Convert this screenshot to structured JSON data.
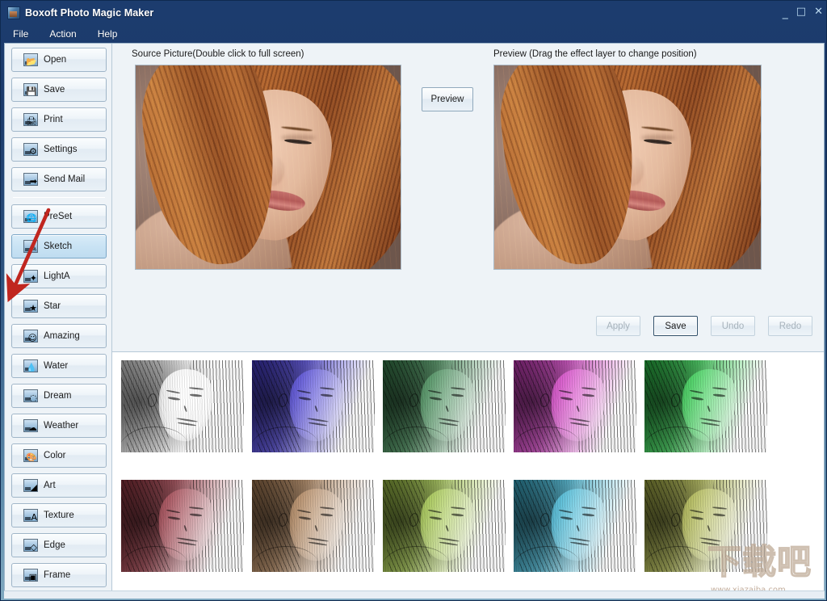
{
  "window": {
    "title": "Boxoft Photo Magic Maker",
    "icon": "app-photo-icon",
    "controls": {
      "minimize": "_",
      "maximize": "□",
      "close": "✕"
    }
  },
  "menubar": {
    "items": [
      {
        "label": "File"
      },
      {
        "label": "Action"
      },
      {
        "label": "Help"
      }
    ]
  },
  "sidebar": {
    "file_group": [
      {
        "label": "Open",
        "icon": "open-folder-icon",
        "glyph": "📂",
        "selected": false
      },
      {
        "label": "Save",
        "icon": "floppy-disk-icon",
        "glyph": "💾",
        "selected": false
      },
      {
        "label": "Print",
        "icon": "printer-icon",
        "glyph": "🖨",
        "selected": false
      },
      {
        "label": "Settings",
        "icon": "gear-envelope-icon",
        "glyph": "⚙",
        "selected": false
      },
      {
        "label": "Send Mail",
        "icon": "send-mail-icon",
        "glyph": "➡",
        "selected": false
      }
    ],
    "effect_group": [
      {
        "label": "PreSet",
        "icon": "preset-globe-icon",
        "glyph": "🌐",
        "selected": false
      },
      {
        "label": "Sketch",
        "icon": "sketch-pen-icon",
        "glyph": "✎",
        "selected": true
      },
      {
        "label": "LightA",
        "icon": "light-effect-icon",
        "glyph": "✦",
        "selected": false
      },
      {
        "label": "Star",
        "icon": "star-effect-icon",
        "glyph": "★",
        "selected": false
      },
      {
        "label": "Amazing",
        "icon": "amazing-smiley-icon",
        "glyph": "☺",
        "selected": false
      },
      {
        "label": "Water",
        "icon": "water-drop-icon",
        "glyph": "💧",
        "selected": false
      },
      {
        "label": "Dream",
        "icon": "dream-swirl-icon",
        "glyph": "◌",
        "selected": false
      },
      {
        "label": "Weather",
        "icon": "weather-icon",
        "glyph": "☁",
        "selected": false
      },
      {
        "label": "Color",
        "icon": "color-palette-icon",
        "glyph": "🎨",
        "selected": false
      },
      {
        "label": "Art",
        "icon": "art-brush-icon",
        "glyph": "◢",
        "selected": false
      },
      {
        "label": "Texture",
        "icon": "texture-letter-icon",
        "glyph": "A",
        "selected": false
      },
      {
        "label": "Edge",
        "icon": "edge-diamond-icon",
        "glyph": "◇",
        "selected": false
      },
      {
        "label": "Frame",
        "icon": "frame-icon",
        "glyph": "▣",
        "selected": false
      }
    ]
  },
  "annotation": {
    "arrow": {
      "name": "red-pointer-arrow",
      "points_to": "Star",
      "color": "#c0261f"
    }
  },
  "editor": {
    "source_label": "Source Picture(Double click to full screen)",
    "preview_label": "Preview (Drag the effect layer to change position)",
    "preview_button": "Preview",
    "actions": [
      {
        "label": "Apply",
        "enabled": false,
        "focused": false
      },
      {
        "label": "Save",
        "enabled": true,
        "focused": true
      },
      {
        "label": "Undo",
        "enabled": false,
        "focused": false
      },
      {
        "label": "Redo",
        "enabled": false,
        "focused": false
      }
    ]
  },
  "thumbnails": {
    "items": [
      {
        "name": "sketch-variant-grey",
        "tint": "#7d7d7d"
      },
      {
        "name": "sketch-variant-blue-violet",
        "tint": "#4a3fe0"
      },
      {
        "name": "sketch-variant-dark-green",
        "tint": "#3f8f55"
      },
      {
        "name": "sketch-variant-magenta",
        "tint": "#e03fd0"
      },
      {
        "name": "sketch-variant-bright-green",
        "tint": "#2fd84f"
      },
      {
        "name": "sketch-variant-maroon",
        "tint": "#a43a47"
      },
      {
        "name": "sketch-variant-tan",
        "tint": "#b8875a"
      },
      {
        "name": "sketch-variant-yellow-green",
        "tint": "#a8cf48"
      },
      {
        "name": "sketch-variant-cyan",
        "tint": "#3fbfe0"
      },
      {
        "name": "sketch-variant-olive",
        "tint": "#b5be4a"
      }
    ]
  },
  "watermark": {
    "characters": "下载吧",
    "url": "www.xiazaiba.com"
  }
}
